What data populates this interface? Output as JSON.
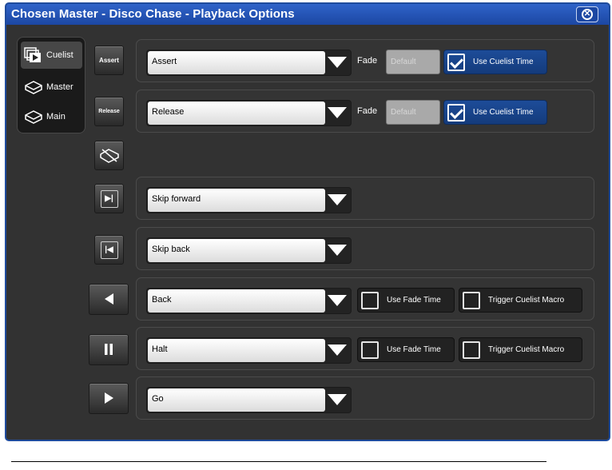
{
  "window": {
    "title": "Chosen Master - Disco Chase - Playback Options",
    "close_icon": "close-icon",
    "colors": {
      "titlebar": "#1c47a3",
      "background": "#323232",
      "checked_toggle": "#1d4c99"
    }
  },
  "sidebar": {
    "items": [
      {
        "label": "Cuelist",
        "icon": "cuelist-icon",
        "active": true
      },
      {
        "label": "Master",
        "icon": "master-icon",
        "active": false
      },
      {
        "label": "Main",
        "icon": "main-icon",
        "active": false
      }
    ]
  },
  "buttons": {
    "assert_label": "Assert",
    "release_label": "Release"
  },
  "rows": {
    "assert": {
      "value": "Assert",
      "fade_label": "Fade",
      "fade_placeholder": "Default",
      "use_cuelist_time": "Use Cuelist Time",
      "checked": true
    },
    "release": {
      "value": "Release",
      "fade_label": "Fade",
      "fade_placeholder": "Default",
      "use_cuelist_time": "Use Cuelist Time",
      "checked": true
    },
    "skip_forward": {
      "value": "Skip forward"
    },
    "skip_back": {
      "value": "Skip back"
    },
    "back": {
      "value": "Back",
      "use_fade_time": "Use Fade Time",
      "trigger_macro": "Trigger Cuelist Macro"
    },
    "halt": {
      "value": "Halt",
      "use_fade_time": "Use Fade Time",
      "trigger_macro": "Trigger Cuelist Macro"
    },
    "go": {
      "value": "Go"
    }
  }
}
